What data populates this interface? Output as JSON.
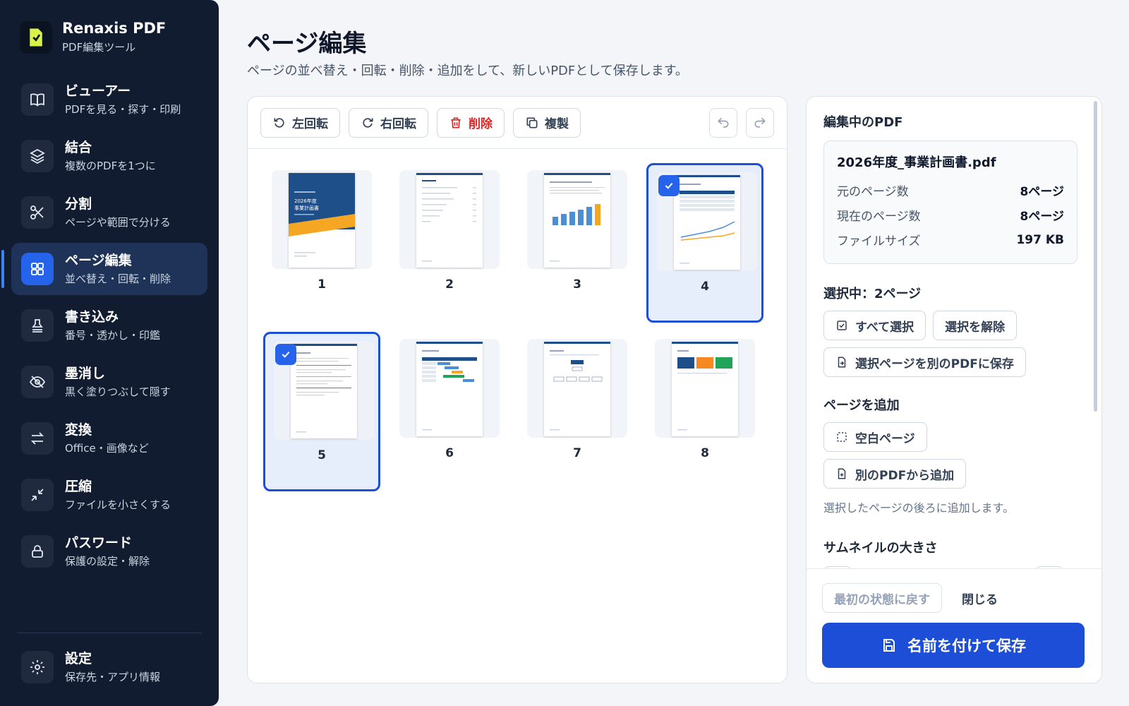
{
  "brand": {
    "name": "Renaxis PDF",
    "subtitle": "PDF編集ツール"
  },
  "sidebar": {
    "items": [
      {
        "title": "ビューアー",
        "sub": "PDFを見る・探す・印刷",
        "icon": "book-icon"
      },
      {
        "title": "結合",
        "sub": "複数のPDFを1つに",
        "icon": "layers-icon"
      },
      {
        "title": "分割",
        "sub": "ページや範囲で分ける",
        "icon": "scissors-icon"
      },
      {
        "title": "ページ編集",
        "sub": "並べ替え・回転・削除",
        "icon": "grid-icon",
        "active": true
      },
      {
        "title": "書き込み",
        "sub": "番号・透かし・印鑑",
        "icon": "stamp-icon"
      },
      {
        "title": "墨消し",
        "sub": "黒く塗りつぶして隠す",
        "icon": "eye-off-icon"
      },
      {
        "title": "変換",
        "sub": "Office・画像など",
        "icon": "convert-icon"
      },
      {
        "title": "圧縮",
        "sub": "ファイルを小さくする",
        "icon": "compress-icon"
      },
      {
        "title": "パスワード",
        "sub": "保護の設定・解除",
        "icon": "lock-icon"
      }
    ],
    "settings": {
      "title": "設定",
      "sub": "保存先・アプリ情報",
      "icon": "gear-icon"
    }
  },
  "main": {
    "title": "ページ編集",
    "description": "ページの並べ替え・回転・削除・追加をして、新しいPDFとして保存します。"
  },
  "toolbar": {
    "rotate_left": "左回転",
    "rotate_right": "右回転",
    "delete": "削除",
    "duplicate": "複製"
  },
  "pages": [
    {
      "num": "1",
      "selected": false
    },
    {
      "num": "2",
      "selected": false
    },
    {
      "num": "3",
      "selected": false
    },
    {
      "num": "4",
      "selected": true
    },
    {
      "num": "5",
      "selected": true
    },
    {
      "num": "6",
      "selected": false
    },
    {
      "num": "7",
      "selected": false
    },
    {
      "num": "8",
      "selected": false
    }
  ],
  "thumbnail_text": {
    "cover_title": "2026年度",
    "cover_title2": "事業計画書"
  },
  "panel": {
    "section_title": "編集中のPDF",
    "file_name": "2026年度_事業計画書.pdf",
    "rows": [
      {
        "label": "元のページ数",
        "value": "8ページ"
      },
      {
        "label": "現在のページ数",
        "value": "8ページ"
      },
      {
        "label": "ファイルサイズ",
        "value": "197 KB"
      }
    ],
    "selection_title": "選択中：2ページ",
    "select_all": "すべて選択",
    "deselect": "選択を解除",
    "save_selected": "選択ページを別のPDFに保存",
    "add_title": "ページを追加",
    "blank_page": "空白ページ",
    "from_pdf": "別のPDFから追加",
    "add_hint": "選択したページの後ろに追加します。",
    "thumb_size_title": "サムネイルの大きさ"
  },
  "footer": {
    "reset": "最初の状態に戻す",
    "close": "閉じる",
    "save_as": "名前を付けて保存"
  },
  "colors": {
    "accent": "#1d4ed8",
    "sidebar": "#111c30",
    "danger": "#dc2626",
    "brand_logo": "#d9f24a"
  }
}
